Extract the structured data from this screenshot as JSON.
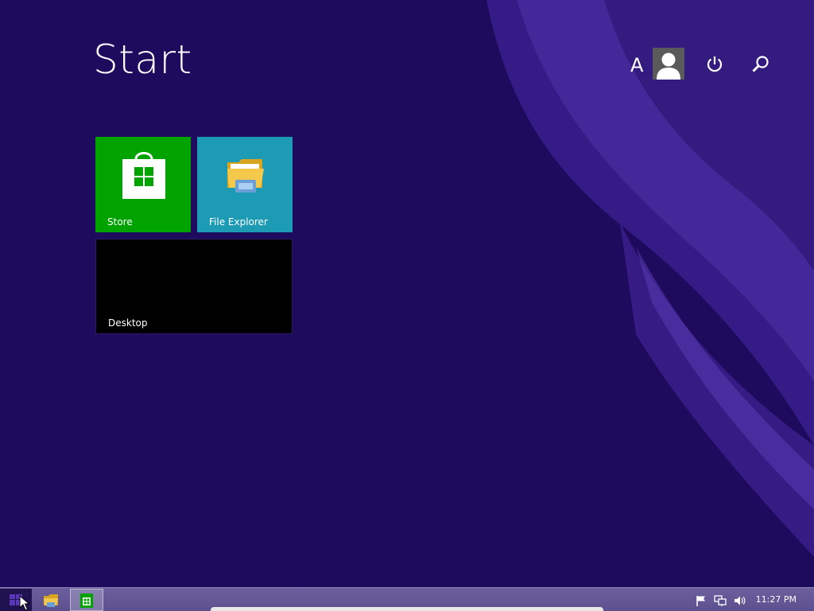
{
  "start": {
    "title": "Start"
  },
  "user": {
    "initial": "A"
  },
  "tiles": [
    {
      "label": "Store",
      "color": "#00a300",
      "icon": "store-bag-icon"
    },
    {
      "label": "File Explorer",
      "color": "#1d9bb5",
      "icon": "folder-icon"
    },
    {
      "label": "Desktop",
      "color": "#000000",
      "icon": ""
    }
  ],
  "taskbar": {
    "items": [
      {
        "name": "start-button",
        "icon": "windows-logo-icon"
      },
      {
        "name": "file-explorer",
        "icon": "folder-icon"
      },
      {
        "name": "store",
        "icon": "store-bag-icon"
      }
    ],
    "tray": [
      "flag-icon",
      "network-icon",
      "volume-icon"
    ],
    "clock": "11:27 PM"
  },
  "colors": {
    "background": "#1e0b5e",
    "accent": "#5a37b8",
    "taskbar": "#6b5f9d"
  }
}
